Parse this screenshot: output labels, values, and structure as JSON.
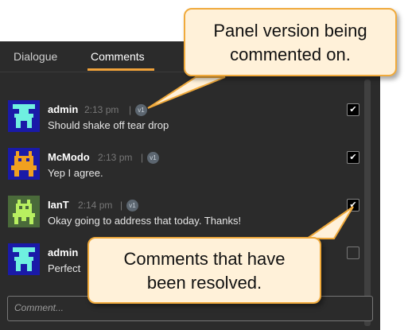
{
  "tabs": [
    {
      "label": "Dialogue"
    },
    {
      "label": "Comments",
      "active": true
    }
  ],
  "comments": [
    {
      "author": "admin",
      "time": "2:13 pm",
      "version": "v1",
      "text": "Should shake off tear drop",
      "resolved": true,
      "avatar": "admin-avatar"
    },
    {
      "author": "McModo",
      "time": "2:13 pm",
      "version": "v1",
      "text": "Yep I agree.",
      "resolved": true,
      "avatar": "mcmodo-avatar"
    },
    {
      "author": "IanT",
      "time": "2:14 pm",
      "version": "v1",
      "text": "Okay going to address that today. Thanks!",
      "resolved": true,
      "avatar": "iant-avatar"
    },
    {
      "author": "admin",
      "time": "",
      "version": "",
      "text": "Perfect",
      "resolved": false,
      "avatar": "admin-avatar"
    }
  ],
  "comment_input": {
    "placeholder": "Comment..."
  },
  "callouts": {
    "version": {
      "line1": "Panel version being",
      "line2": "commented on."
    },
    "resolved": {
      "line1": "Comments that have",
      "line2": "been resolved."
    }
  },
  "colors": {
    "panel": "#2b2b2b",
    "accent": "#f0a23a",
    "callout_fill": "#fff1d9",
    "callout_border": "#f0aa3c"
  }
}
